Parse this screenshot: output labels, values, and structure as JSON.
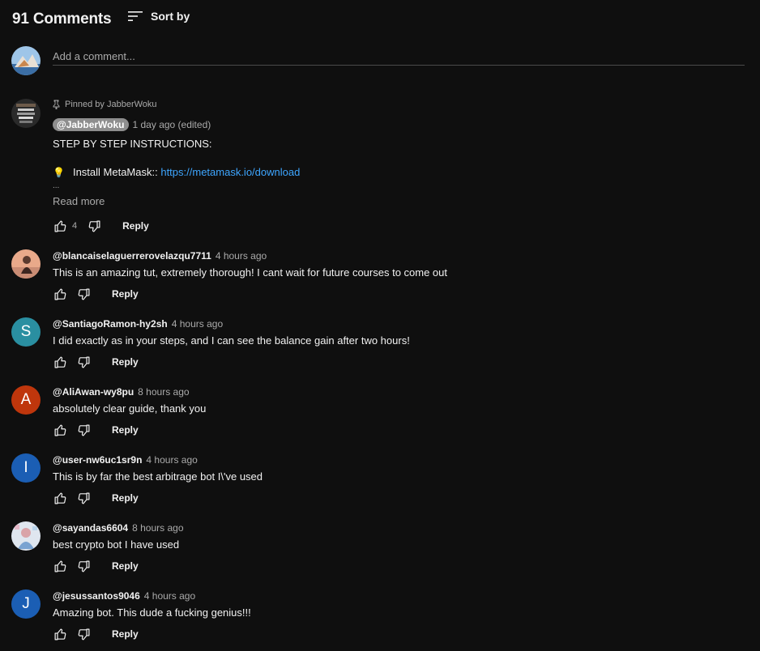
{
  "header": {
    "count_label": "91 Comments",
    "sort_label": "Sort by"
  },
  "add_comment": {
    "placeholder": "Add a comment..."
  },
  "pinned": {
    "pinned_label": "Pinned by JabberWoku",
    "author": "@JabberWoku",
    "time": "1 day ago (edited)",
    "line1": "STEP BY STEP INSTRUCTIONS:",
    "bulb": "💡",
    "install_label": "Install MetaMask::",
    "link": "https://metamask.io/download",
    "ellipsis": "...",
    "read_more": "Read more",
    "likes": "4",
    "reply": "Reply"
  },
  "comments": [
    {
      "author": "@blancaiselaguerrerovelazqu7711",
      "time": "4 hours ago",
      "text": "This is an amazing tut, extremely thorough! I cant wait for future courses to come out",
      "reply": "Reply"
    },
    {
      "author": "@SantiagoRamon-hy2sh",
      "time": "4 hours ago",
      "text": "I did exactly as in your steps, and I can see the balance gain after two hours!",
      "reply": "Reply",
      "initial": "S",
      "color": "#2a8fa1"
    },
    {
      "author": "@AliAwan-wy8pu",
      "time": "8 hours ago",
      "text": "absolutely clear guide, thank you",
      "reply": "Reply",
      "initial": "A",
      "color": "#bf360c"
    },
    {
      "author": "@user-nw6uc1sr9n",
      "time": "4 hours ago",
      "text": "This is by far the best arbitrage bot I\\'ve used",
      "reply": "Reply",
      "initial": "I",
      "color": "#1b5eb4"
    },
    {
      "author": "@sayandas6604",
      "time": "8 hours ago",
      "text": "best crypto bot I have used",
      "reply": "Reply"
    },
    {
      "author": "@jesussantos9046",
      "time": "4 hours ago",
      "text": "Amazing bot. This dude a fucking genius!!!",
      "reply": "Reply",
      "initial": "J",
      "color": "#1b5eb4"
    }
  ]
}
